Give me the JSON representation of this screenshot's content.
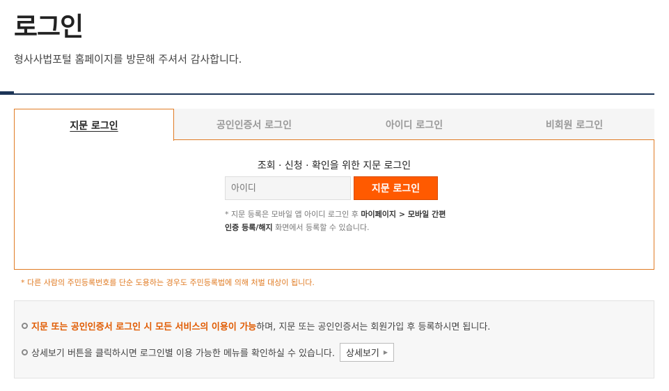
{
  "header": {
    "title": "로그인",
    "subtitle": "형사사법포털 홈페이지를 방문해 주셔서 감사합니다."
  },
  "tabs": [
    {
      "label": "지문 로그인",
      "active": true
    },
    {
      "label": "공인인증서 로그인",
      "active": false
    },
    {
      "label": "아이디 로그인",
      "active": false
    },
    {
      "label": "비회원 로그인",
      "active": false
    }
  ],
  "panel": {
    "heading": "조회 · 신청 · 확인을 위한 지문 로그인",
    "id_placeholder": "아이디",
    "login_button": "지문 로그인",
    "note_part1": "* 지문 등록은 모바일 앱 아이디 로그인 후 ",
    "note_bold1": "마이페이지 > 모바일 간편인증 등록/해지",
    "note_part2": " 화면에서 등록할 수 있습니다."
  },
  "warning": "* 다른 사람의 주민등록번호를 단순 도용하는 경우도 주민등록법에 의해 처벌 대상이 됩니다.",
  "info": {
    "line1_highlight": "지문 또는 공인인증서 로그인 시 모든 서비스의 이용이 가능",
    "line1_rest": "하며, 지문 또는 공인인증서는 회원가입 후 등록하시면 됩니다.",
    "line2_text": "상세보기 버튼을 클릭하시면 로그인별 이용 가능한 메뉴를 확인하실 수 있습니다.",
    "detail_button": "상세보기"
  },
  "colors": {
    "accent": "#e07b23",
    "button": "#ff5a00",
    "divider": "#1d3557"
  }
}
